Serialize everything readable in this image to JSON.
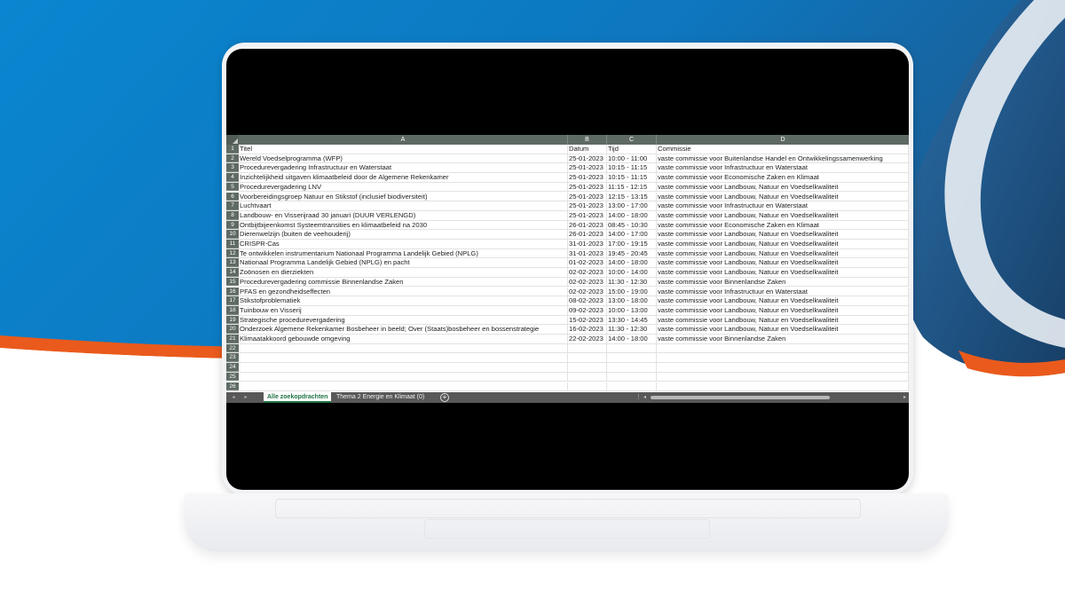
{
  "spreadsheet": {
    "columns": [
      "A",
      "B",
      "C",
      "D"
    ],
    "header": {
      "titel": "Titel",
      "datum": "Datum",
      "tijd": "Tijd",
      "commissie": "Commissie"
    },
    "rows": [
      {
        "titel": "Wereld Voedselprogramma (WFP)",
        "datum": "25-01-2023",
        "tijd": "10:00 - 11:00",
        "commissie": "vaste commissie voor Buitenlandse Handel en Ontwikkelingssamenwerking"
      },
      {
        "titel": "Procedurevergadering Infrastructuur en Waterstaat",
        "datum": "25-01-2023",
        "tijd": "10:15 - 11:15",
        "commissie": "vaste commissie voor Infrastructuur en Waterstaat"
      },
      {
        "titel": "Inzichtelijkheid uitgaven klimaatbeleid door de Algemene Rekenkamer",
        "datum": "25-01-2023",
        "tijd": "10:15 - 11:15",
        "commissie": "vaste commissie voor Economische Zaken en Klimaat"
      },
      {
        "titel": "Procedurevergadering LNV",
        "datum": "25-01-2023",
        "tijd": "11:15 - 12:15",
        "commissie": "vaste commissie voor Landbouw, Natuur en Voedselkwaliteit"
      },
      {
        "titel": "Voorbereidingsgroep Natuur en Stikstof (inclusief biodiversiteit)",
        "datum": "25-01-2023",
        "tijd": "12:15 - 13:15",
        "commissie": "vaste commissie voor Landbouw, Natuur en Voedselkwaliteit"
      },
      {
        "titel": "Luchtvaart",
        "datum": "25-01-2023",
        "tijd": "13:00 - 17:00",
        "commissie": "vaste commissie voor Infrastructuur en Waterstaat"
      },
      {
        "titel": "Landbouw- en Visserijraad 30 januari (DUUR VERLENGD)",
        "datum": "25-01-2023",
        "tijd": "14:00 - 18:00",
        "commissie": "vaste commissie voor Landbouw, Natuur en Voedselkwaliteit"
      },
      {
        "titel": "Ontbijtbijeenkomst Systeemtransities en klimaatbeleid na 2030",
        "datum": "26-01-2023",
        "tijd": "08:45 - 10:30",
        "commissie": "vaste commissie voor Economische Zaken en Klimaat"
      },
      {
        "titel": "Dierenwelzijn (buiten de veehouderij)",
        "datum": "26-01-2023",
        "tijd": "14:00 - 17:00",
        "commissie": "vaste commissie voor Landbouw, Natuur en Voedselkwaliteit"
      },
      {
        "titel": "CRISPR-Cas",
        "datum": "31-01-2023",
        "tijd": "17:00 - 19:15",
        "commissie": "vaste commissie voor Landbouw, Natuur en Voedselkwaliteit"
      },
      {
        "titel": "Te ontwikkelen instrumentarium Nationaal Programma Landelijk Gebied (NPLG)",
        "datum": "31-01-2023",
        "tijd": "19:45 - 20:45",
        "commissie": "vaste commissie voor Landbouw, Natuur en Voedselkwaliteit"
      },
      {
        "titel": "Nationaal Programma Landelijk Gebied (NPLG) en pacht",
        "datum": "01-02-2023",
        "tijd": "14:00 - 18:00",
        "commissie": "vaste commissie voor Landbouw, Natuur en Voedselkwaliteit"
      },
      {
        "titel": "Zoönosen en dierziekten",
        "datum": "02-02-2023",
        "tijd": "10:00 - 14:00",
        "commissie": "vaste commissie voor Landbouw, Natuur en Voedselkwaliteit"
      },
      {
        "titel": "Procedurevergadering commissie Binnenlandse Zaken",
        "datum": "02-02-2023",
        "tijd": "11:30 - 12:30",
        "commissie": "vaste commissie voor Binnenlandse Zaken"
      },
      {
        "titel": "PFAS en gezondheidseffecten",
        "datum": "02-02-2023",
        "tijd": "15:00 - 19:00",
        "commissie": "vaste commissie voor Infrastructuur en Waterstaat"
      },
      {
        "titel": "Stikstofproblematiek",
        "datum": "08-02-2023",
        "tijd": "13:00 - 18:00",
        "commissie": "vaste commissie voor Landbouw, Natuur en Voedselkwaliteit"
      },
      {
        "titel": "Tuinbouw en Visserij",
        "datum": "09-02-2023",
        "tijd": "10:00 - 13:00",
        "commissie": "vaste commissie voor Landbouw, Natuur en Voedselkwaliteit"
      },
      {
        "titel": "Strategische procedurevergadering",
        "datum": "15-02-2023",
        "tijd": "13:30 - 14:45",
        "commissie": "vaste commissie voor Landbouw, Natuur en Voedselkwaliteit"
      },
      {
        "titel": "Onderzoek Algemene Rekenkamer Bosbeheer in beeld; Over (Staats)bosbeheer en bossenstrategie",
        "datum": "16-02-2023",
        "tijd": "11:30 - 12:30",
        "commissie": "vaste commissie voor Landbouw, Natuur en Voedselkwaliteit"
      },
      {
        "titel": "Klimaatakkoord gebouwde omgeving",
        "datum": "22-02-2023",
        "tijd": "14:00 - 18:00",
        "commissie": "vaste commissie voor Binnenlandse Zaken"
      }
    ],
    "row_numbers": [
      "1",
      "2",
      "3",
      "4",
      "5",
      "6",
      "7",
      "8",
      "9",
      "10",
      "11",
      "12",
      "13",
      "14",
      "15",
      "16",
      "17",
      "18",
      "19",
      "20",
      "21",
      "22",
      "23",
      "24",
      "25",
      "26"
    ],
    "tabs": [
      {
        "label": "Alle zoekopdrachten",
        "active": true
      },
      {
        "label": "Thema 2 Energie en Klimaat (0)",
        "active": false
      }
    ],
    "add_sheet_symbol": "+",
    "nav_prev_symbol": "◂",
    "nav_next_symbol": "▸",
    "split_symbol": "⋮",
    "scroll_left_symbol": "◂",
    "scroll_right_symbol": "▸"
  },
  "colors": {
    "header_bg": "#5e6a63",
    "active_tab_accent": "#1f7244",
    "bg_blue": "#0a86d0",
    "bg_navy": "#1d4f7c",
    "bg_orange": "#ea5a1c"
  }
}
